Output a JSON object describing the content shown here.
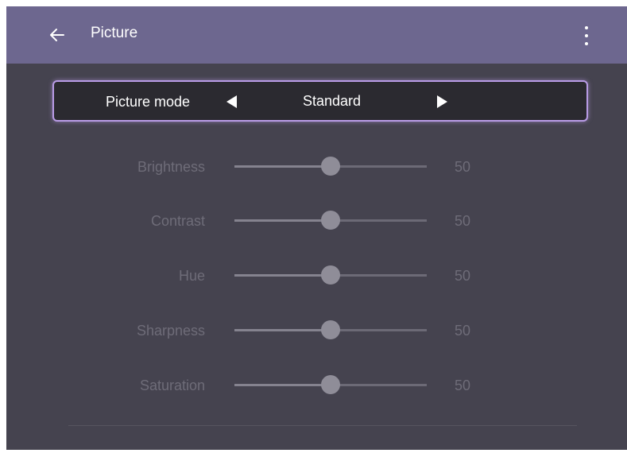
{
  "header": {
    "title": "Picture",
    "back_icon": "arrow-left-icon",
    "menu_icon": "more-vertical-icon"
  },
  "picture_mode": {
    "label": "Picture mode",
    "value": "Standard",
    "prev_icon": "triangle-left-icon",
    "next_icon": "triangle-right-icon"
  },
  "settings": [
    {
      "label": "Brightness",
      "value": "50",
      "level": 50
    },
    {
      "label": "Contrast",
      "value": "50",
      "level": 50
    },
    {
      "label": "Hue",
      "value": "50",
      "level": 50
    },
    {
      "label": "Sharpness",
      "value": "50",
      "level": 50
    },
    {
      "label": "Saturation",
      "value": "50",
      "level": 50
    }
  ],
  "colors": {
    "header_bg": "#6d678f",
    "panel_bg": "#45434f",
    "highlight_border": "#b99be6",
    "disabled_text": "#6e6c78"
  }
}
